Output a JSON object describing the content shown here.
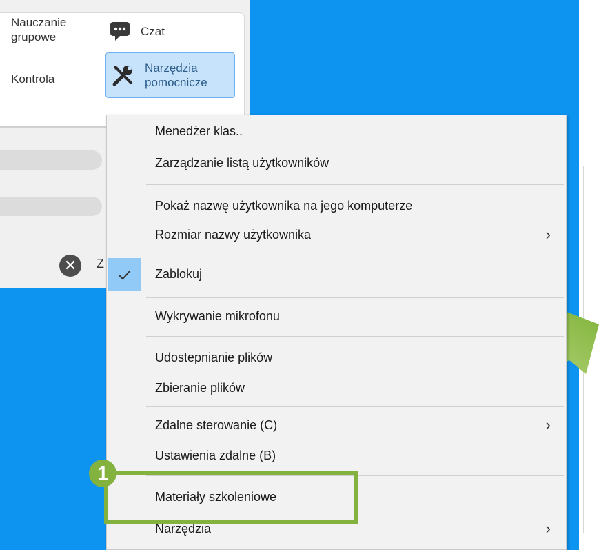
{
  "ribbon": {
    "group_teaching_label": "Nauczanie grupowe",
    "control_label": "Kontrola",
    "chat_label": "Czat",
    "tools_label": "Narzędzia pomocnicze"
  },
  "panel": {
    "close_label": "Z"
  },
  "context_menu": {
    "items": [
      {
        "label": "Menedżer klas.."
      },
      {
        "label": "Zarządzanie listą użytkowników"
      },
      {
        "label": "Pokaż nazwę użytkownika na jego komputerze"
      },
      {
        "label": "Rozmiar nazwy użytkownika",
        "submenu": true
      },
      {
        "label": "Zablokuj",
        "checked": true
      },
      {
        "label": "Wykrywanie mikrofonu"
      },
      {
        "label": "Udostepnianie plików"
      },
      {
        "label": "Zbieranie plików"
      },
      {
        "label": "Zdalne sterowanie (C)",
        "submenu": true
      },
      {
        "label": "Ustawienia zdalne (B)"
      },
      {
        "label": "Materiały szkoleniowe"
      },
      {
        "label": "Narzędzia",
        "submenu": true
      }
    ],
    "submenu_glyph": "›"
  },
  "annotation": {
    "badge_number": "1",
    "highlight_color": "#84b23f"
  },
  "colors": {
    "desktop_blue": "#0d93f0",
    "menu_bg": "#f2f2f2",
    "selected_bg": "#c7e2fb",
    "check_bg": "#91c9f7"
  },
  "icons": {
    "chat": "chat-bubble-icon",
    "tools": "wrench-screwdriver-icon",
    "close": "close-circle-icon",
    "check": "checkmark-icon",
    "arrow": "green-arrow-icon"
  }
}
